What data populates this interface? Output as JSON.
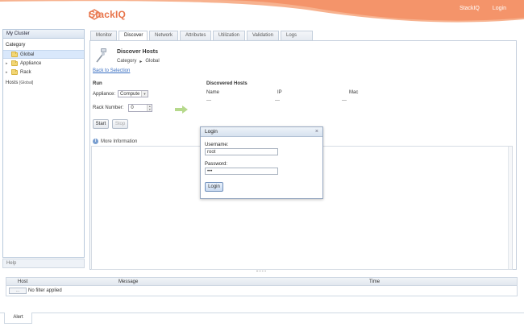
{
  "header": {
    "brand": "StackIQ",
    "links": [
      "StackIQ",
      "Login"
    ],
    "colors": {
      "band": "#f4946a",
      "band_light": "#f7b28f",
      "logo": "#e8744a"
    }
  },
  "left_panel": {
    "title": "My Cluster",
    "category_label": "Category",
    "tree": [
      {
        "label": "Global",
        "selected": true
      },
      {
        "label": "Appliance",
        "selected": false
      },
      {
        "label": "Rack",
        "selected": false
      }
    ],
    "hosts_label": "Hosts",
    "hosts_tag": "[Global]",
    "help_label": "Help"
  },
  "tabs": [
    {
      "label": "Monitor",
      "active": false
    },
    {
      "label": "Discover",
      "active": true
    },
    {
      "label": "Network",
      "active": false
    },
    {
      "label": "Attributes",
      "active": false
    },
    {
      "label": "Utilization",
      "active": false
    },
    {
      "label": "Validation",
      "active": false
    },
    {
      "label": "Logs",
      "active": false
    }
  ],
  "discover": {
    "title": "Discover Hosts",
    "crumb_category": "Category",
    "crumb_sep": "▸",
    "crumb_value": "Global",
    "back_link": "Back to Selection",
    "run_title": "Run",
    "appliance_label": "Appliance:",
    "appliance_value": "Compute",
    "rack_label": "Rack Number:",
    "rack_value": "0",
    "start_label": "Start",
    "stop_label": "Stop",
    "discovered_title": "Discovered Hosts",
    "columns": [
      "Name",
      "IP",
      "Mac"
    ],
    "placeholder_value": "---",
    "more_info": "More Information"
  },
  "login_dialog": {
    "title": "Login",
    "close": "×",
    "username_label": "Username:",
    "username_value": "root",
    "password_label": "Password:",
    "password_value": "•••",
    "button": "Login"
  },
  "bottom_grid": {
    "columns": [
      "Host",
      "Message",
      "Time"
    ],
    "filter_button": "...",
    "no_filter": "No filter applied"
  },
  "alert_tab": "Alert"
}
